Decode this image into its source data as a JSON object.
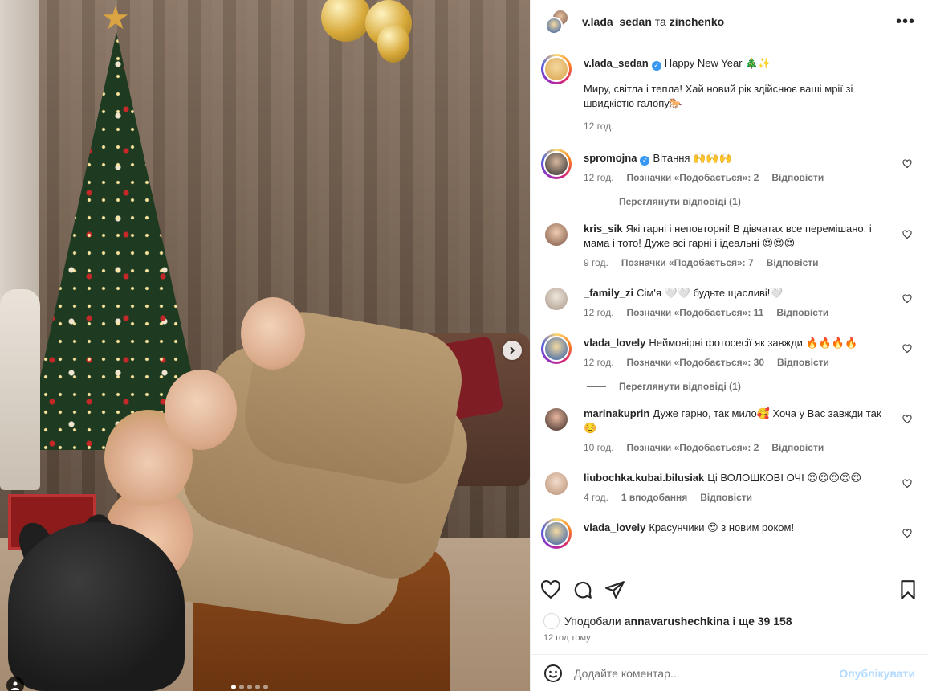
{
  "header": {
    "user1": "v.lada_sedan",
    "separator": "та",
    "user2": "zinchenko",
    "more_icon": "more-horizontal-icon"
  },
  "caption": {
    "username": "v.lada_sedan",
    "title": "Happy New Year 🎄✨",
    "text": "Миру, світла і тепла! Хай новий рік здійснює ваші мрії зі швидкістю галопу🐎",
    "time": "12 год."
  },
  "comments": [
    {
      "username": "spromojna",
      "verified": true,
      "text": "Вітання 🙌🙌🙌",
      "time": "12 год.",
      "likes": "Позначки «Подобається»: 2",
      "reply": "Відповісти",
      "view_replies": "Переглянути відповіді (1)",
      "avatar_color": "#3a3a3a"
    },
    {
      "username": "kris_sik",
      "verified": false,
      "text": "Які гарні і неповторні! В дівчатах все перемішано, і мама і тото! Дуже всі гарні і ідеальні 😍😍😍",
      "time": "9 год.",
      "likes": "Позначки «Подобається»: 7",
      "reply": "Відповісти",
      "avatar_color": "#8a6a54"
    },
    {
      "username": "_family_zi",
      "verified": false,
      "text": "Сім'я 🤍🤍 будьте щасливі!🤍",
      "time": "12 год.",
      "likes": "Позначки «Подобається»: 11",
      "reply": "Відповісти",
      "avatar_color": "#c9b7a6"
    },
    {
      "username": "vlada_lovely",
      "verified": false,
      "text": "Неймовірні фотосесії як завжди 🔥🔥🔥🔥",
      "time": "12 год.",
      "likes": "Позначки «Подобається»: 30",
      "reply": "Відповісти",
      "view_replies": "Переглянути відповіді (1)",
      "avatar_color": "#e7c15a"
    },
    {
      "username": "marinakuprin",
      "verified": false,
      "text": "Дуже гарно, так мило🥰 Хоча у Вас завжди так ☺️",
      "time": "10 год.",
      "likes": "Позначки «Подобається»: 2",
      "reply": "Відповісти",
      "avatar_color": "#5b3a2e"
    },
    {
      "username": "liubochka.kubai.bilusiak",
      "verified": false,
      "text": "Ці ВОЛОШКОВІ ОЧІ 😍😍😍😍😍",
      "time": "4 год.",
      "likes": "1 вподобання",
      "reply": "Відповісти",
      "avatar_color": "#d8b9a0"
    },
    {
      "username": "vlada_lovely",
      "verified": false,
      "text": "Красунчики 😍 з новим роком!",
      "time": "",
      "likes": "",
      "reply": "",
      "avatar_color": "#e7c15a"
    }
  ],
  "likes_line": {
    "prefix": "Уподобали",
    "user": "annavarushechkina",
    "suffix": "і ще 39 158"
  },
  "posted_ago": "12 год тому",
  "composer": {
    "placeholder": "Додайте коментар...",
    "post_label": "Опублікувати"
  },
  "colors": {
    "verified": "#3897f0",
    "post_button": "#b3dbff",
    "muted": "#737373"
  }
}
